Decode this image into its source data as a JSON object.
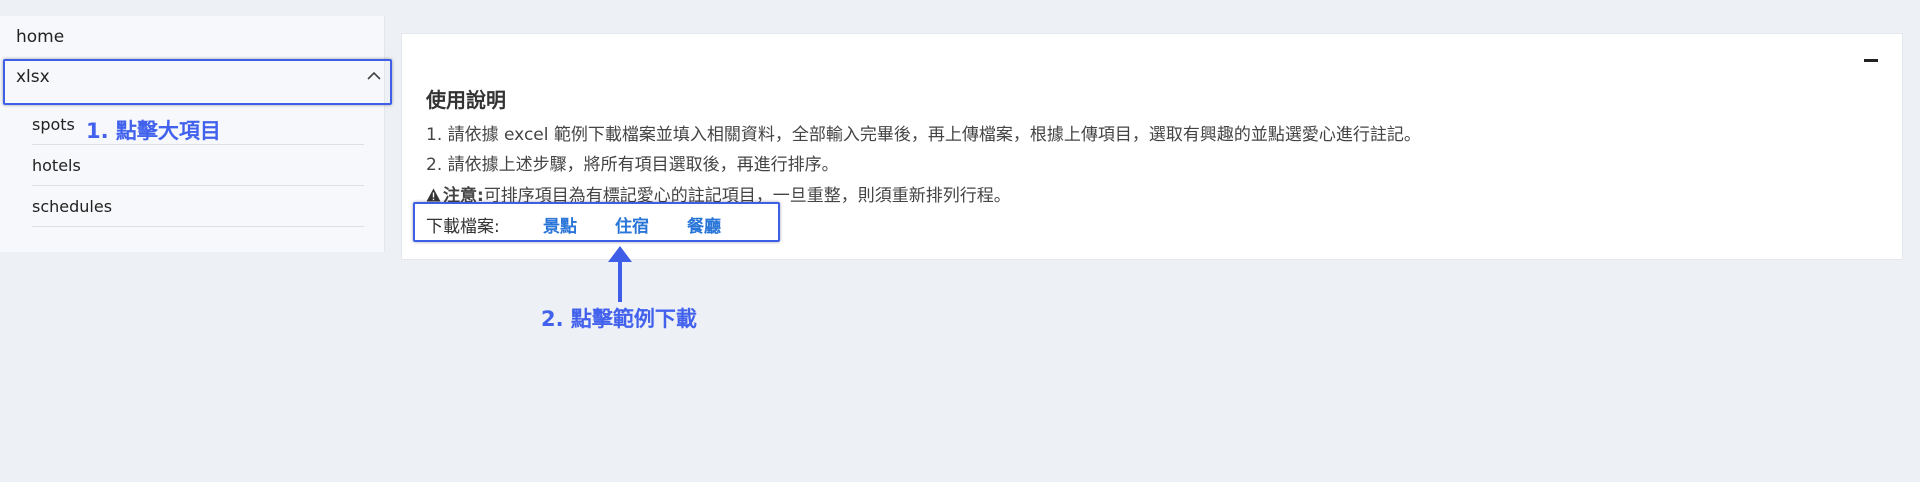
{
  "sidebar": {
    "home": "home",
    "xlsx": "xlsx",
    "children": [
      "spots",
      "hotels",
      "schedules"
    ]
  },
  "annotations": {
    "step1": "1. 點擊大項目",
    "step2": "2. 點擊範例下載",
    "color": "#3f5ee8"
  },
  "card": {
    "title": "使用說明",
    "line1": "1. 請依據 excel 範例下載檔案並填入相關資料，全部輸入完畢後，再上傳檔案，根據上傳項目，選取有興趣的並點選愛心進行註記。",
    "line2": "2. 請依據上述步驟，將所有項目選取後，再進行排序。",
    "warning_label": "注意:",
    "warning_text": "可排序項目為有標記愛心的註記項目，一旦重整，則須重新排列行程。",
    "download_label": "下載檔案:",
    "download_links": [
      "景點",
      "住宿",
      "餐廳"
    ]
  },
  "icons": {
    "collapse": "minus-icon",
    "xlsx_toggle": "chevron-up-icon",
    "warning": "warning-triangle-icon",
    "arrow": "arrow-up-icon"
  },
  "colors": {
    "link": "#2a76d8",
    "background": "#edf0f4"
  }
}
